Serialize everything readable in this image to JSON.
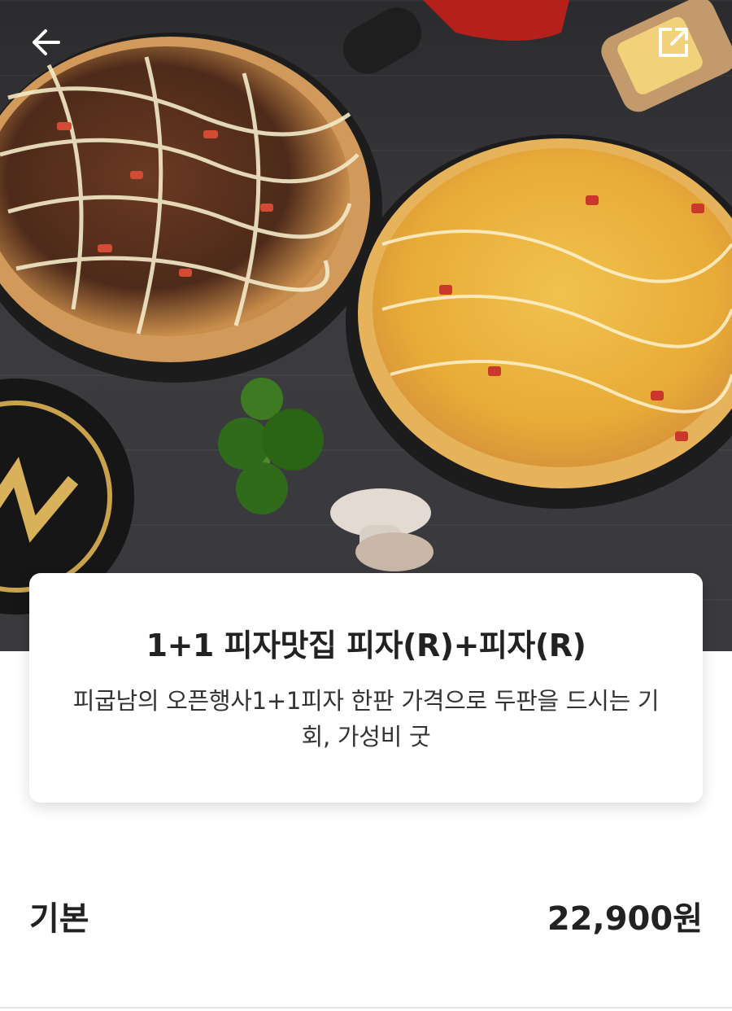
{
  "header": {
    "back_icon": "arrow-left-icon",
    "share_icon": "external-link-icon"
  },
  "product": {
    "title": "1+1 피자맛집 피자(R)+피자(R)",
    "description": "피굽남의 오픈행사1+1피자 한판 가격으로 두판을 드시는 기회, 가성비 굿"
  },
  "option": {
    "label": "기본",
    "price": "22,900원"
  },
  "colors": {
    "text": "#222222",
    "divider": "#e6e6e6"
  }
}
